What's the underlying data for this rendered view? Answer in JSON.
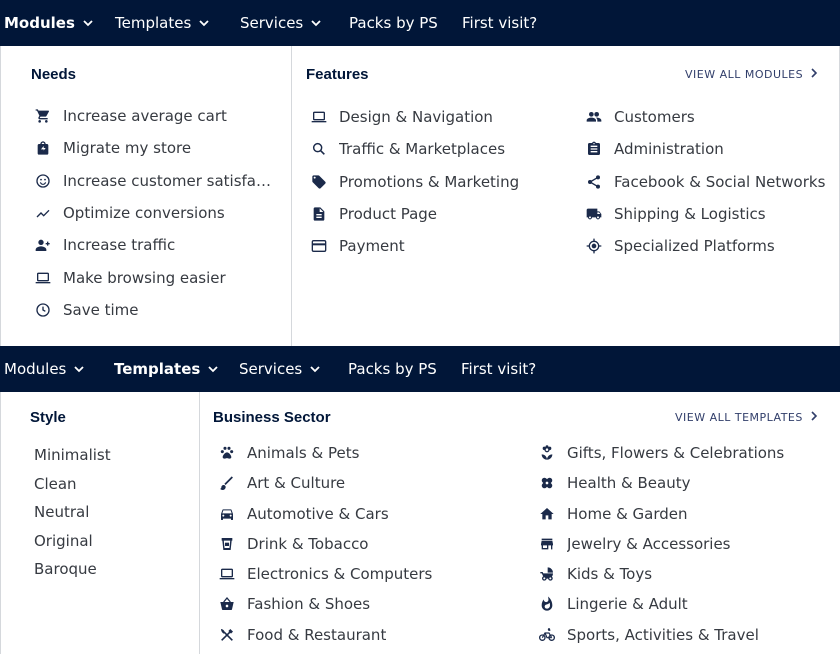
{
  "colors": {
    "nav_bg": "#011638",
    "heading": "#011638",
    "text": "#363a41",
    "accent": "#313e6a"
  },
  "nav1": {
    "items": [
      {
        "label": "Modules",
        "dropdown": true
      },
      {
        "label": "Templates",
        "dropdown": true
      },
      {
        "label": "Services",
        "dropdown": true
      },
      {
        "label": "Packs by PS",
        "dropdown": false
      },
      {
        "label": "First visit?",
        "dropdown": false
      }
    ]
  },
  "modules_menu": {
    "needs_heading": "Needs",
    "features_heading": "Features",
    "view_all": "VIEW ALL MODULES",
    "needs": [
      {
        "label": "Increase average cart",
        "icon": "cart-icon"
      },
      {
        "label": "Migrate my store",
        "icon": "store-bag-icon"
      },
      {
        "label": "Increase customer satisfacti…",
        "icon": "smiley-icon"
      },
      {
        "label": "Optimize conversions",
        "icon": "trend-icon"
      },
      {
        "label": "Increase traffic",
        "icon": "add-user-icon"
      },
      {
        "label": "Make browsing easier",
        "icon": "laptop-icon"
      },
      {
        "label": "Save time",
        "icon": "clock-icon"
      }
    ],
    "features_col1": [
      {
        "label": "Design & Navigation",
        "icon": "laptop-icon"
      },
      {
        "label": "Traffic & Marketplaces",
        "icon": "search-icon"
      },
      {
        "label": "Promotions & Marketing",
        "icon": "tag-icon"
      },
      {
        "label": "Product Page",
        "icon": "document-icon"
      },
      {
        "label": "Payment",
        "icon": "credit-card-icon"
      }
    ],
    "features_col2": [
      {
        "label": "Customers",
        "icon": "people-icon"
      },
      {
        "label": "Administration",
        "icon": "clipboard-icon"
      },
      {
        "label": "Facebook & Social Networks",
        "icon": "share-icon"
      },
      {
        "label": "Shipping & Logistics",
        "icon": "truck-icon"
      },
      {
        "label": "Specialized Platforms",
        "icon": "target-icon"
      }
    ]
  },
  "nav2": {
    "items": [
      {
        "label": "Modules",
        "dropdown": true
      },
      {
        "label": "Templates",
        "dropdown": true
      },
      {
        "label": "Services",
        "dropdown": true
      },
      {
        "label": "Packs by PS",
        "dropdown": false
      },
      {
        "label": "First visit?",
        "dropdown": false
      }
    ]
  },
  "templates_menu": {
    "style_heading": "Style",
    "sector_heading": "Business Sector",
    "view_all": "VIEW ALL TEMPLATES",
    "styles": [
      "Minimalist",
      "Clean",
      "Neutral",
      "Original",
      "Baroque"
    ],
    "sector_col1": [
      {
        "label": "Animals & Pets",
        "icon": "paw-icon"
      },
      {
        "label": "Art & Culture",
        "icon": "brush-icon"
      },
      {
        "label": "Automotive & Cars",
        "icon": "car-icon"
      },
      {
        "label": "Drink & Tobacco",
        "icon": "drink-icon"
      },
      {
        "label": "Electronics & Computers",
        "icon": "laptop-icon"
      },
      {
        "label": "Fashion & Shoes",
        "icon": "basket-icon"
      },
      {
        "label": "Food & Restaurant",
        "icon": "cutlery-icon"
      }
    ],
    "sector_col2": [
      {
        "label": "Gifts, Flowers & Celebrations",
        "icon": "flower-icon"
      },
      {
        "label": "Health & Beauty",
        "icon": "bandage-icon"
      },
      {
        "label": "Home & Garden",
        "icon": "home-icon"
      },
      {
        "label": "Jewelry & Accessories",
        "icon": "shop-icon"
      },
      {
        "label": "Kids & Toys",
        "icon": "stroller-icon"
      },
      {
        "label": "Lingerie & Adult",
        "icon": "flame-icon"
      },
      {
        "label": "Sports, Activities & Travel",
        "icon": "bike-icon"
      }
    ]
  }
}
